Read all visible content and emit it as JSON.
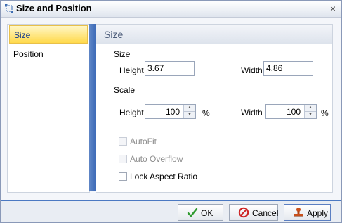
{
  "dialog": {
    "title": "Size and Position"
  },
  "nav": {
    "items": [
      {
        "label": "Size",
        "active": true
      },
      {
        "label": "Position",
        "active": false
      }
    ]
  },
  "panel": {
    "title": "Size",
    "size_section": "Size",
    "height_label": "Height",
    "height_value": "3.67",
    "width_label": "Width",
    "width_value": "4.86",
    "scale_section": "Scale",
    "scale_height_label": "Height",
    "scale_height_value": "100",
    "scale_width_label": "Width",
    "scale_width_value": "100",
    "percent": "%",
    "autofit": "AutoFit",
    "auto_overflow": "Auto Overflow",
    "lock_aspect": "Lock Aspect Ratio"
  },
  "buttons": {
    "ok": "OK",
    "cancel": "Cancel",
    "apply": "Apply"
  },
  "colors": {
    "accent": "#4b79c2",
    "ok_icon": "#2f9a2f",
    "cancel_icon": "#cc2222"
  }
}
